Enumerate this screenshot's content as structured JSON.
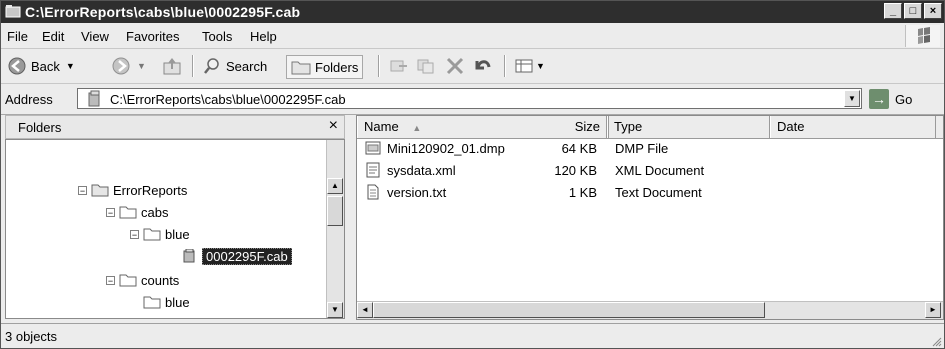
{
  "window": {
    "title": "C:\\ErrorReports\\cabs\\blue\\0002295F.cab"
  },
  "caption_buttons": {
    "minimize": "_",
    "maximize": "□",
    "close": "×"
  },
  "menu": [
    {
      "label": "File"
    },
    {
      "label": "Edit"
    },
    {
      "label": "View"
    },
    {
      "label": "Favorites"
    },
    {
      "label": "Tools"
    },
    {
      "label": "Help"
    }
  ],
  "toolbar": {
    "back": "Back",
    "search": "Search",
    "folders": "Folders"
  },
  "address": {
    "label": "Address",
    "value": "C:\\ErrorReports\\cabs\\blue\\0002295F.cab",
    "go": "Go"
  },
  "folders_pane": {
    "title": "Folders",
    "close": "×",
    "tree": [
      {
        "label": "ErrorReports",
        "toggle": "⊟"
      },
      {
        "label": "cabs",
        "toggle": "⊟"
      },
      {
        "label": "blue",
        "toggle": "⊟"
      },
      {
        "label": "0002295F.cab",
        "selected": true
      },
      {
        "label": "counts",
        "toggle": "⊟"
      },
      {
        "label": "blue"
      }
    ]
  },
  "list": {
    "columns": [
      "Name",
      "Size",
      "Type",
      "Date"
    ],
    "rows": [
      {
        "name": "Mini120902_01.dmp",
        "size": "64 KB",
        "type": "DMP File",
        "date": ""
      },
      {
        "name": "sysdata.xml",
        "size": "120 KB",
        "type": "XML Document",
        "date": ""
      },
      {
        "name": "version.txt",
        "size": "1 KB",
        "type": "Text Document",
        "date": ""
      }
    ]
  },
  "status": {
    "text": "3 objects"
  },
  "colors": {
    "titlebar": "#2e2e2e",
    "window": "#ececec",
    "selection": "#222222"
  }
}
